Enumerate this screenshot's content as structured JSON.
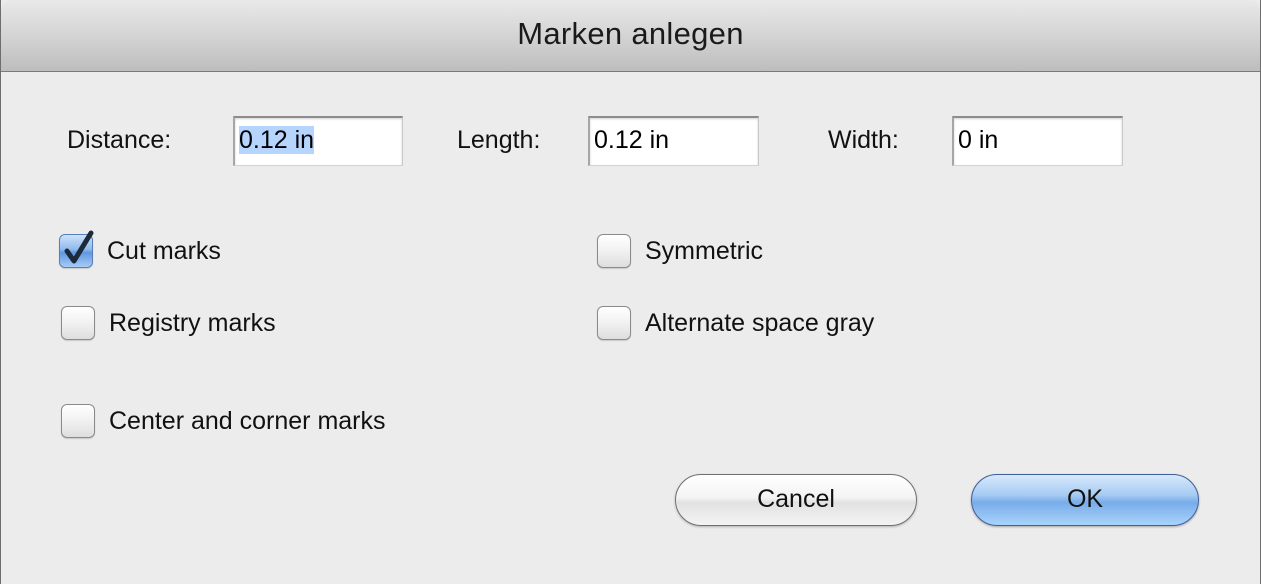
{
  "dialog": {
    "title": "Marken anlegen"
  },
  "fields": {
    "distance": {
      "label": "Distance:",
      "value": "0.12 in"
    },
    "length": {
      "label": "Length:",
      "value": "0.12 in"
    },
    "width": {
      "label": "Width:",
      "value": "0 in"
    }
  },
  "checkboxes": {
    "cut_marks": {
      "label": "Cut marks",
      "checked": true
    },
    "symmetric": {
      "label": "Symmetric",
      "checked": false
    },
    "registry_marks": {
      "label": "Registry marks",
      "checked": false
    },
    "alternate_space_gray": {
      "label": "Alternate space gray",
      "checked": false
    },
    "center_corner_marks": {
      "label": "Center and corner marks",
      "checked": false
    }
  },
  "buttons": {
    "cancel": "Cancel",
    "ok": "OK"
  },
  "colors": {
    "selection": "#b5d5ff",
    "default_button": "#78acea",
    "dialog_background": "#ececec"
  },
  "icons": {
    "checkmark": "checkmark-icon"
  }
}
